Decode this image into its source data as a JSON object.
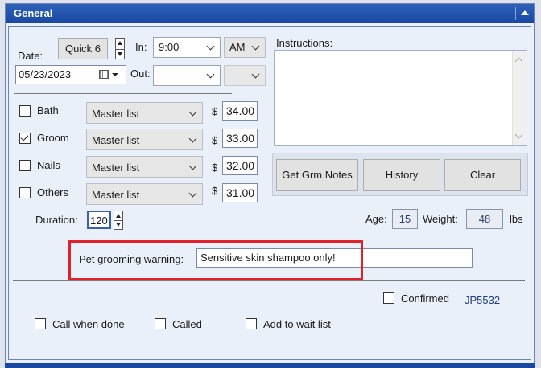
{
  "window": {
    "title": "General"
  },
  "date": {
    "label": "Date:",
    "quick_button": "Quick 6",
    "value": "05/23/2023"
  },
  "time": {
    "in_label": "In:",
    "in_value": "9:00",
    "in_ampm": "AM",
    "out_label": "Out:",
    "out_value": "",
    "out_ampm": ""
  },
  "services": [
    {
      "name": "Bath",
      "checked": false,
      "list": "Master list",
      "currency": "$",
      "price": "34.00"
    },
    {
      "name": "Groom",
      "checked": true,
      "list": "Master list",
      "currency": "$",
      "price": "33.00"
    },
    {
      "name": "Nails",
      "checked": false,
      "list": "Master list",
      "currency": "$",
      "price": "32.00"
    },
    {
      "name": "Others",
      "checked": false,
      "list": "Master list",
      "currency": "$",
      "price": "31.00"
    }
  ],
  "duration": {
    "label": "Duration:",
    "value": "120"
  },
  "instructions": {
    "label": "Instructions:",
    "value": ""
  },
  "buttons": {
    "get_notes": "Get Grm Notes",
    "history": "History",
    "clear": "Clear"
  },
  "pet_info": {
    "age_label": "Age:",
    "age": "15",
    "weight_label": "Weight:",
    "weight": "48",
    "weight_unit": "lbs"
  },
  "warning": {
    "label": "Pet grooming warning:",
    "value": "Sensitive skin shampoo only!"
  },
  "confirmed": {
    "label": "Confirmed",
    "checked": false,
    "code": "JP5532"
  },
  "options": {
    "call_when_done": "Call when done",
    "called": "Called",
    "add_to_wait_list": "Add to wait list"
  },
  "colors": {
    "title_bar": "#1a48a0",
    "panel_bg": "#eaf0fa",
    "highlight": "#e0202a",
    "code_text": "#1f3a7a"
  }
}
